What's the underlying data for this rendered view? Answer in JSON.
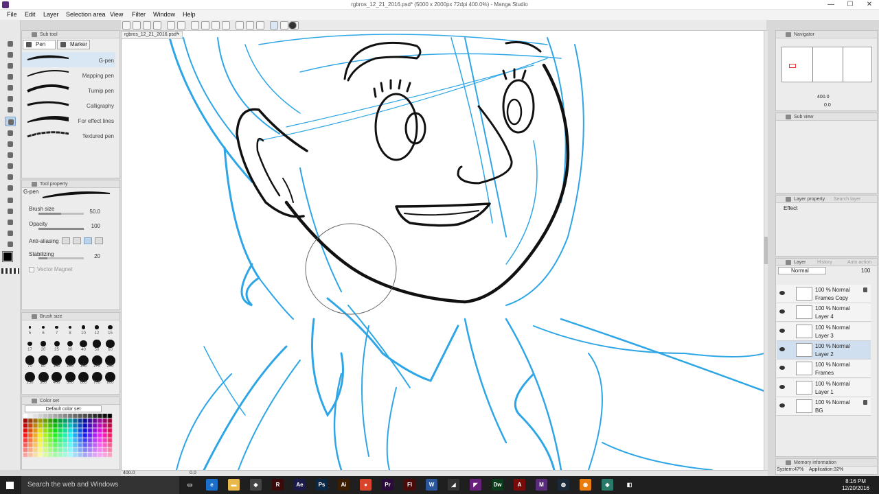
{
  "window": {
    "title": "rgbros_12_21_2016.psd* (5000 x 2000px 72dpi 400.0%) - Manga Studio",
    "minimize": "—",
    "maximize": "☐",
    "close": "✕"
  },
  "menu": [
    "File",
    "Edit",
    "Layer",
    "Selection area",
    "View",
    "Filter",
    "Window",
    "Help"
  ],
  "subtool": {
    "header": "Sub tool",
    "tabs": [
      "Pen",
      "Marker"
    ],
    "brushes": [
      "G-pen",
      "Mapping pen",
      "Turnip pen",
      "Calligraphy",
      "For effect lines",
      "Textured pen"
    ],
    "selected": "G-pen"
  },
  "tool_property": {
    "header": "Tool property",
    "brush_name": "G-pen",
    "brush_size_label": "Brush size",
    "brush_size": "50.0",
    "brush_size_frac": 0.5,
    "opacity_label": "Opacity",
    "opacity": "100",
    "opacity_frac": 1.0,
    "aa_label": "Anti-aliasing",
    "stabilizing_label": "Stabilizing",
    "stabilizing": "20",
    "stabilizing_frac": 0.2,
    "vector_magnet_label": "Vector Magnet"
  },
  "brush_size_panel": {
    "header": "Brush size",
    "sizes": [
      "5",
      "6",
      "7",
      "8",
      "10",
      "12",
      "15",
      "17",
      "20",
      "25",
      "30",
      "40",
      "50",
      "60",
      "70",
      "80",
      "100",
      "120",
      "150",
      "170",
      "200",
      "250",
      "300",
      "400",
      "500",
      "600",
      "700",
      "800"
    ]
  },
  "color_set": {
    "header": "Color set",
    "set_name": "Default color set"
  },
  "document": {
    "tab": "rgbros_12_21_2016.psd*",
    "zoom": "400.0",
    "angle": "0.0"
  },
  "navigator": {
    "header": "Navigator",
    "zoom": "400.0",
    "rotation": "0.0"
  },
  "subview": {
    "header": "Sub view"
  },
  "layer_property": {
    "header": "Layer property",
    "tab2": "Search layer",
    "effect_label": "Effect"
  },
  "layer_panel": {
    "header": "Layer",
    "tab2": "History",
    "tab3": "Auto action",
    "blend_mode": "Normal",
    "opacity": "100",
    "layers": [
      {
        "mode": "100 %  Normal",
        "name": "Frames Copy",
        "locked": true,
        "selected": false
      },
      {
        "mode": "100 %  Normal",
        "name": "Layer 4",
        "locked": false,
        "selected": false
      },
      {
        "mode": "100 %  Normal",
        "name": "Layer 3",
        "locked": false,
        "selected": false
      },
      {
        "mode": "100 %  Normal",
        "name": "Layer 2",
        "locked": false,
        "selected": true
      },
      {
        "mode": "100 %  Normal",
        "name": "Frames",
        "locked": false,
        "selected": false
      },
      {
        "mode": "100 %  Normal",
        "name": "Layer 1",
        "locked": false,
        "selected": false
      },
      {
        "mode": "100 %  Normal",
        "name": "BG",
        "locked": true,
        "selected": false
      }
    ]
  },
  "memory": {
    "header": "Memory information",
    "system": "System:47%",
    "application": "Application:32%"
  },
  "taskbar": {
    "search_placeholder": "Search the web and Windows",
    "apps": [
      {
        "icon": "task-view-icon",
        "label": "▭",
        "color": "#1f1f1f"
      },
      {
        "icon": "edge-icon",
        "label": "e",
        "color": "#1c6fc9"
      },
      {
        "icon": "file-explorer-icon",
        "label": "▬",
        "color": "#e8b84a"
      },
      {
        "icon": "store-icon",
        "label": "◆",
        "color": "#444"
      },
      {
        "icon": "rog-icon",
        "label": "R",
        "color": "#3a0b0b"
      },
      {
        "icon": "after-effects-icon",
        "label": "Ae",
        "color": "#1b1b4a"
      },
      {
        "icon": "photoshop-icon",
        "label": "Ps",
        "color": "#0b2744"
      },
      {
        "icon": "illustrator-icon",
        "label": "Ai",
        "color": "#3b1d00"
      },
      {
        "icon": "chrome-icon",
        "label": "●",
        "color": "#d8452c"
      },
      {
        "icon": "premiere-icon",
        "label": "Pr",
        "color": "#2a0b3b"
      },
      {
        "icon": "flash-icon",
        "label": "Fl",
        "color": "#4a0b0b"
      },
      {
        "icon": "word-icon",
        "label": "W",
        "color": "#2b579a"
      },
      {
        "icon": "unity-icon",
        "label": "◢",
        "color": "#333"
      },
      {
        "icon": "vs-icon",
        "label": "◤",
        "color": "#68217a"
      },
      {
        "icon": "dreamweaver-icon",
        "label": "Dw",
        "color": "#0b3b1b"
      },
      {
        "icon": "acrobat-icon",
        "label": "A",
        "color": "#7a0b0b"
      },
      {
        "icon": "manga-studio-icon",
        "label": "M",
        "color": "#5a2d7a"
      },
      {
        "icon": "steam-icon",
        "label": "◍",
        "color": "#1b2838"
      },
      {
        "icon": "blender-icon",
        "label": "◉",
        "color": "#e87d0d"
      },
      {
        "icon": "app-icon",
        "label": "◈",
        "color": "#2a7a6a"
      },
      {
        "icon": "app2-icon",
        "label": "◧",
        "color": "#1f1f1f"
      }
    ],
    "time": "8:16 PM",
    "date": "12/20/2016"
  },
  "colors": {
    "sketch_blue": "#2ea6e6",
    "ink": "#111111",
    "selection": "#cfdff0"
  }
}
